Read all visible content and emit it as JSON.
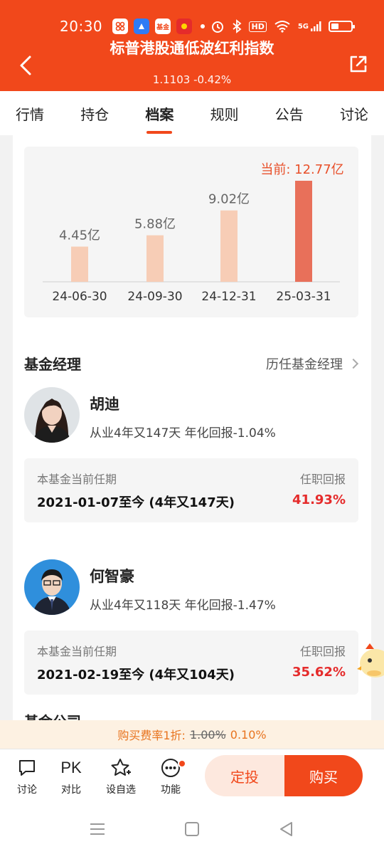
{
  "status_bar": {
    "time": "20:30",
    "app_icons": [
      "shortcut-app",
      "blue-app",
      "fund-app",
      "red-app"
    ],
    "fund_app_text": "基金",
    "network": "5G",
    "hd_label": "HD"
  },
  "header": {
    "title": "标普港股通低波红利指数",
    "nav": "1.1103 -0.42%"
  },
  "tabs": [
    {
      "label": "行情"
    },
    {
      "label": "持仓"
    },
    {
      "label": "档案"
    },
    {
      "label": "规则"
    },
    {
      "label": "公告"
    },
    {
      "label": "讨论"
    }
  ],
  "active_tab": "档案",
  "chart_data": {
    "type": "bar",
    "categories": [
      "24-06-30",
      "24-09-30",
      "24-12-31",
      "25-03-31"
    ],
    "values": [
      4.45,
      5.88,
      9.02,
      12.77
    ],
    "value_labels": [
      "4.45亿",
      "5.88亿",
      "9.02亿",
      "当前: 12.77亿"
    ],
    "title": "",
    "xlabel": "",
    "ylabel": "",
    "colors": {
      "normal": "#f7cdb6",
      "current": "#e8705a",
      "current_label": "#e8502a"
    }
  },
  "managers_section": {
    "title": "基金经理",
    "history_link": "历任基金经理",
    "managers": [
      {
        "name": "胡迪",
        "desc": "从业4年又147天 年化回报-1.04%",
        "tenure_label": "本基金当前任期",
        "tenure_period": "2021-01-07至今 (4年又147天)",
        "return_label": "任职回报",
        "return_value": "41.93%"
      },
      {
        "name": "何智豪",
        "desc": "从业4年又118天 年化回报-1.47%",
        "tenure_label": "本基金当前任期",
        "tenure_period": "2021-02-19至今 (4年又104天)",
        "return_label": "任职回报",
        "return_value": "35.62%"
      }
    ]
  },
  "next_section_title": "基金公司",
  "fee": {
    "label": "购买费率1折:",
    "old": "1.00%",
    "new": "0.10%"
  },
  "bottom_bar": {
    "discuss": "讨论",
    "pk_icon_text": "PK",
    "compare": "对比",
    "watchlist": "设自选",
    "functions": "功能",
    "dingtou": "定投",
    "buy": "购买"
  }
}
